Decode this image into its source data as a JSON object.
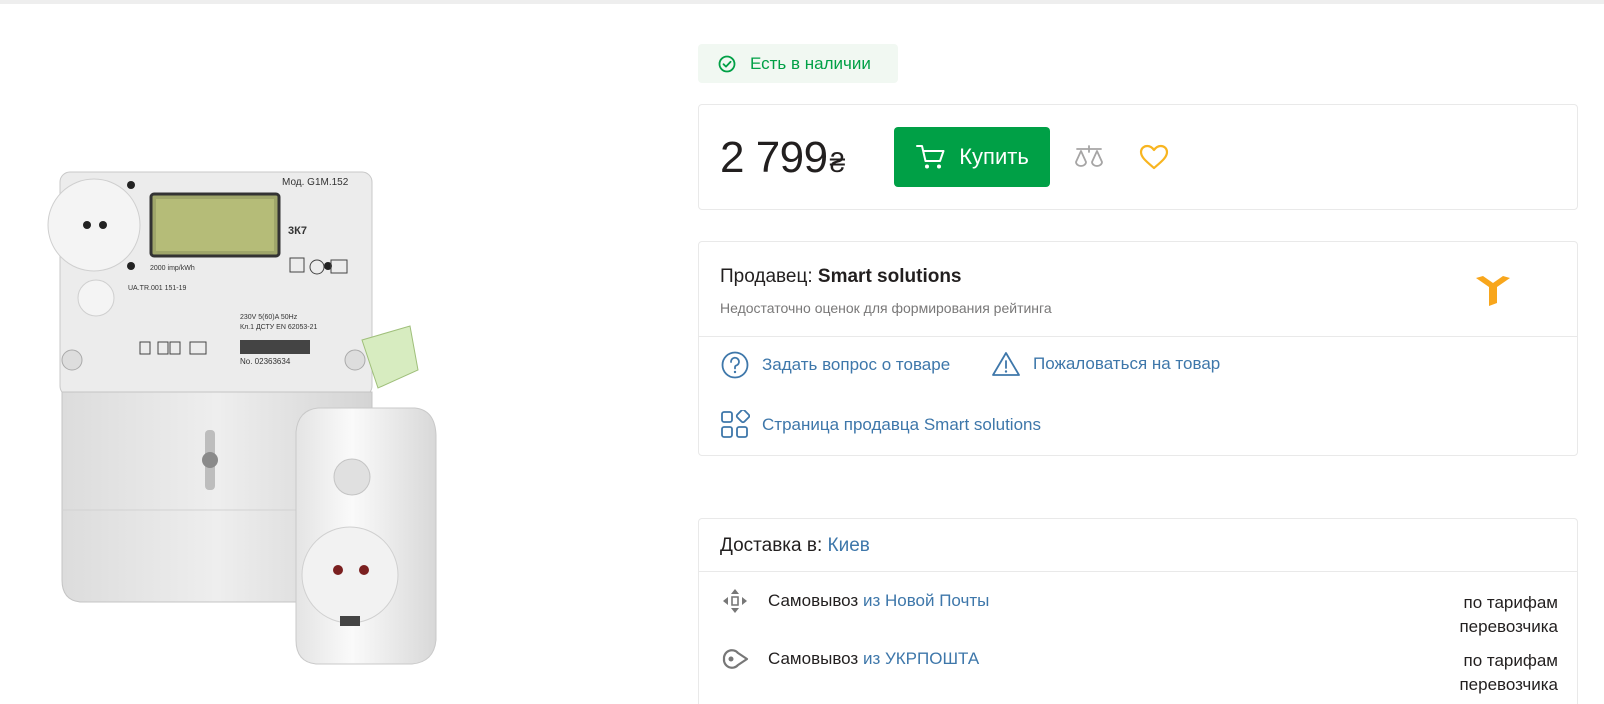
{
  "availability": {
    "label": "Есть в наличии",
    "color": "#00a046"
  },
  "product": {
    "price": "2 799",
    "currency": "₴",
    "buy_label": "Купить",
    "meter_model": "Мод. G1M.152",
    "meter_class": "3К7",
    "meter_imp": "2000 imp/kWh",
    "meter_cert": "UA.TR.001 151-19",
    "meter_rating": "230V 5(60)A  50Hz",
    "meter_standard": "Кл.1 ДСТУ EN 62053-21",
    "meter_number": "No. 02363634"
  },
  "seller": {
    "prefix": "Продавец:",
    "name": "Smart solutions",
    "rating_note": "Недостаточно оценок для формирования рейтинга",
    "ask_label": "Задать вопрос о товаре",
    "complain_label": "Пожаловаться на товар",
    "page_label": "Страница продавца Smart solutions"
  },
  "delivery": {
    "prefix": "Доставка в:",
    "city": "Киев",
    "options": [
      {
        "method": "Самовывоз",
        "source": "из Новой Почты",
        "cost_line1": "по тарифам",
        "cost_line2": "перевозчика",
        "icon": "nova-poshta-icon"
      },
      {
        "method": "Самовывоз",
        "source": "из УКРПОШТА",
        "cost_line1": "по тарифам",
        "cost_line2": "перевозчика",
        "icon": "ukrposhta-icon"
      }
    ]
  },
  "colors": {
    "accent_green": "#00a046",
    "link_blue": "#3e77aa",
    "favorite_yellow": "#f8b520",
    "seller_logo": "#f8a61c"
  }
}
